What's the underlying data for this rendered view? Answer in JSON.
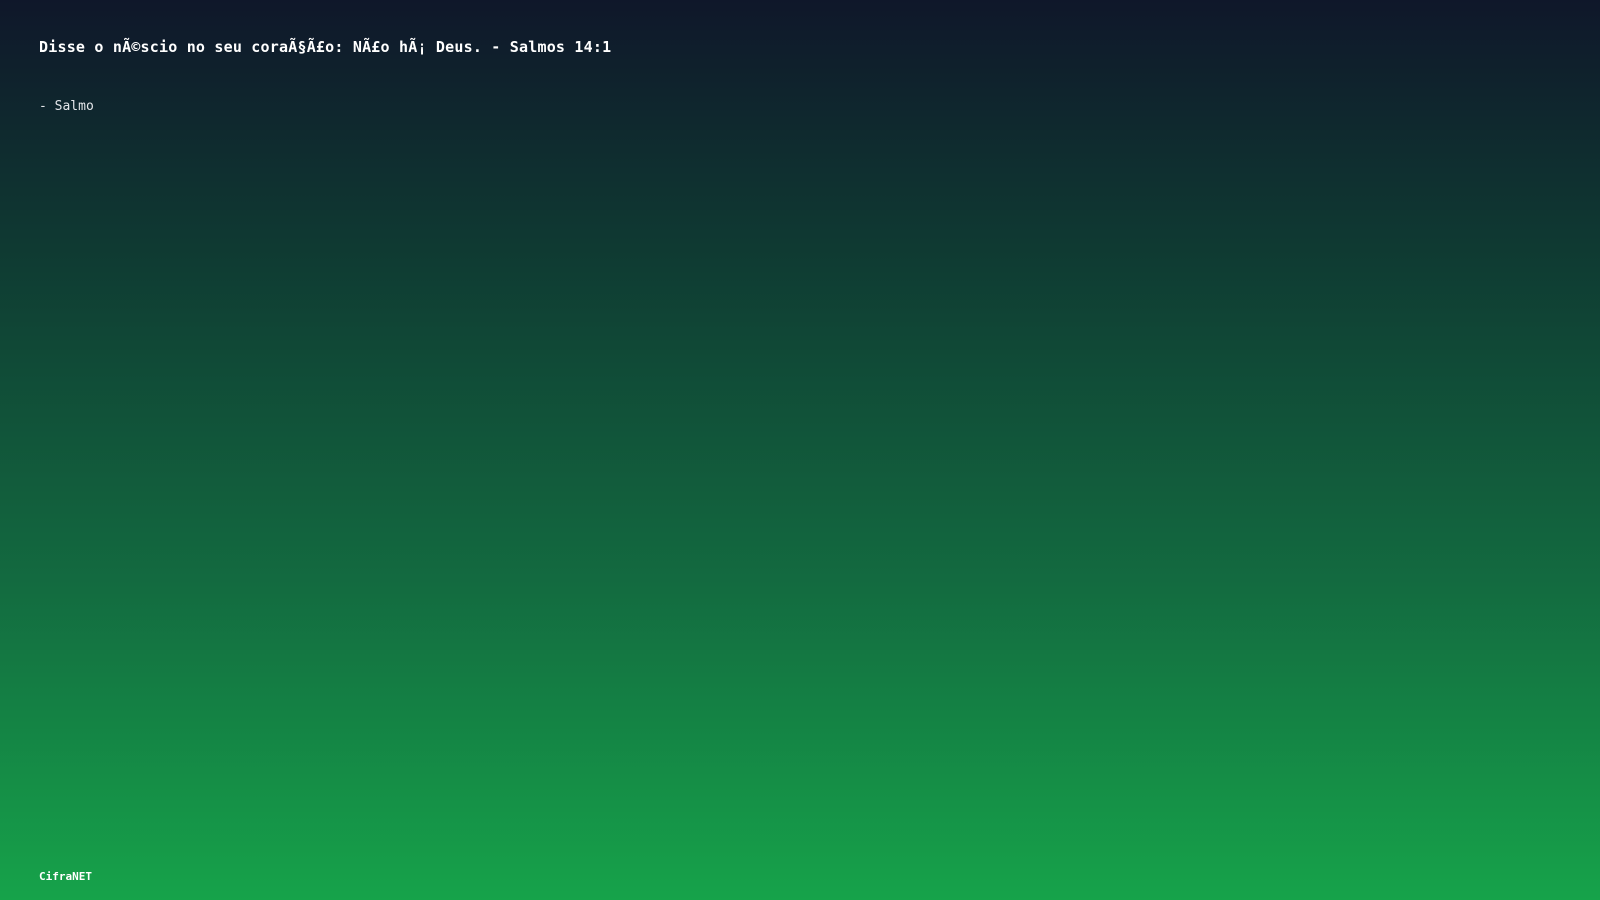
{
  "quote": {
    "text": "Disse o nÃ©scio no seu coraÃ§Ã£o: NÃ£o hÃ¡ Deus. - Salmos 14:1",
    "author": "- Salmo"
  },
  "footer": {
    "brand": "CifraNET"
  },
  "colors": {
    "gradient_top": "#0f172a",
    "gradient_bottom": "#16a34a",
    "text": "#ffffff"
  }
}
